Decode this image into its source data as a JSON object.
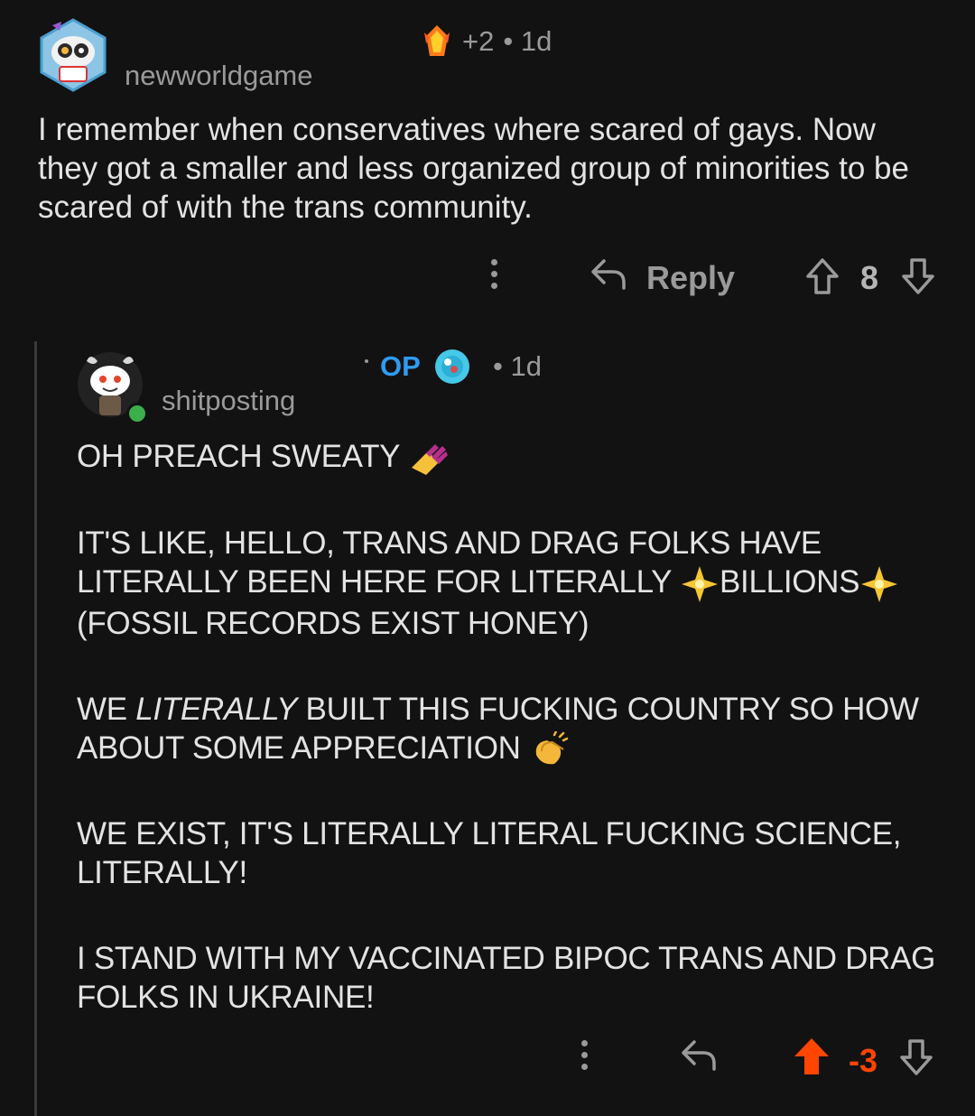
{
  "comment1": {
    "username": "newworldgame",
    "score_delta": "+2",
    "age": "• 1d",
    "body": "I remember when conservatives where scared of gays.  Now they got a smaller and less organized group of minorities to be scared of with the trans community.",
    "reply_label": "Reply",
    "votes": "8"
  },
  "comment2": {
    "op_badge": "OP",
    "age": "• 1d",
    "username": "shitposting",
    "para1": "OH PREACH SWEATY",
    "para2_a": "IT'S LIKE, HELLO, TRANS AND DRAG FOLKS HAVE LITERALLY BEEN HERE FOR LITERALLY ",
    "para2_b": "BILLIONS",
    "para2_c": " (FOSSIL RECORDS EXIST HONEY)",
    "para3_a": "WE ",
    "para3_em": "LITERALLY",
    "para3_b": " BUILT THIS FUCKING COUNTRY SO HOW ABOUT SOME APPRECIATION ",
    "para4": "WE EXIST, IT'S LITERALLY LITERAL FUCKING SCIENCE, LITERALLY!",
    "para5": "I STAND WITH MY VACCINATED BIPOC TRANS AND DRAG FOLKS IN UKRAINE!",
    "votes": "-3"
  },
  "icons": {
    "award": "crystal-award-icon",
    "reply": "reply-arrow-icon",
    "upvote": "upvote-arrow-icon",
    "downvote": "downvote-arrow-icon",
    "more": "more-vertical-icon",
    "nails": "nail-polish-emoji",
    "sparkles": "sparkle-emoji",
    "clap": "clapping-hands-emoji"
  },
  "colors": {
    "background": "#121212",
    "op": "#2e9cf0",
    "upvoted": "#ff4500",
    "muted": "#9a9a9a"
  }
}
